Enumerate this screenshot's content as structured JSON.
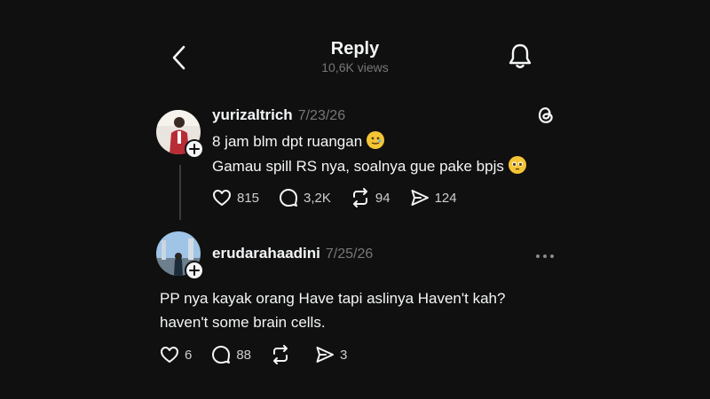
{
  "header": {
    "title": "Reply",
    "views": "10,6K views",
    "back_icon": "chevron-left-icon",
    "bell_icon": "bell-icon"
  },
  "post": {
    "username": "yurizaltrich",
    "date": "7/23/26",
    "line1": "8 jam blm dpt ruangan",
    "line2": "Gamau spill RS nya, soalnya gue pake bpjs",
    "likes": "815",
    "comments": "3,2K",
    "reposts": "94",
    "shares": "124",
    "badge_icon": "threads-logo-icon"
  },
  "reply": {
    "username": "erudarahaadini",
    "date": "7/25/26",
    "line1": "PP nya kayak orang Have tapi aslinya Haven't kah?",
    "line2": "haven't some brain cells.",
    "likes": "6",
    "comments": "88",
    "reposts": "",
    "shares": "3"
  },
  "colors": {
    "background": "#101010",
    "text": "#f3f5f7",
    "muted": "#777777",
    "emoji": "#f4c534"
  }
}
